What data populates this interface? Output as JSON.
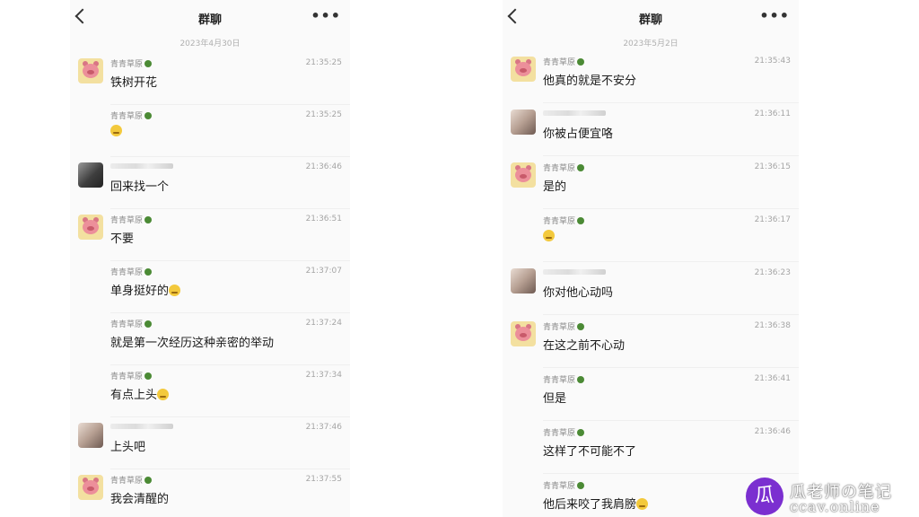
{
  "left": {
    "title": "群聊",
    "more": "•••",
    "date": "2023年4月30日",
    "messages": [
      {
        "avatar": "pig",
        "name": "青青草原",
        "time": "21:35:25",
        "text": "铁树开花",
        "emoji": false
      },
      {
        "avatar": "none",
        "name": "青青草原",
        "time": "21:35:25",
        "text": "",
        "emoji": true
      },
      {
        "avatar": "dark",
        "name": "",
        "time": "21:36:46",
        "text": "回来找一个",
        "emoji": false
      },
      {
        "avatar": "pig",
        "name": "青青草原",
        "time": "21:36:51",
        "text": "不要",
        "emoji": false
      },
      {
        "avatar": "none",
        "name": "青青草原",
        "time": "21:37:07",
        "text": "单身挺好的",
        "emoji": true
      },
      {
        "avatar": "none",
        "name": "青青草原",
        "time": "21:37:24",
        "text": "就是第一次经历这种亲密的举动",
        "emoji": false
      },
      {
        "avatar": "none",
        "name": "青青草原",
        "time": "21:37:34",
        "text": "有点上头",
        "emoji": true
      },
      {
        "avatar": "skin",
        "name": "",
        "time": "21:37:46",
        "text": "上头吧",
        "emoji": false
      },
      {
        "avatar": "pig",
        "name": "青青草原",
        "time": "21:37:55",
        "text": "我会清醒的",
        "emoji": false
      }
    ]
  },
  "right": {
    "title": "群聊",
    "more": "•••",
    "date": "2023年5月2日",
    "messages": [
      {
        "avatar": "pig",
        "name": "青青草原",
        "time": "21:35:43",
        "text": "他真的就是不安分",
        "emoji": false
      },
      {
        "avatar": "skin",
        "name": "",
        "time": "21:36:11",
        "text": "你被占便宜咯",
        "emoji": false
      },
      {
        "avatar": "pig",
        "name": "青青草原",
        "time": "21:36:15",
        "text": "是的",
        "emoji": false
      },
      {
        "avatar": "none",
        "name": "青青草原",
        "time": "21:36:17",
        "text": "",
        "emoji": true
      },
      {
        "avatar": "skin",
        "name": "",
        "time": "21:36:23",
        "text": "你对他心动吗",
        "emoji": false
      },
      {
        "avatar": "pig",
        "name": "青青草原",
        "time": "21:36:38",
        "text": "在这之前不心动",
        "emoji": false
      },
      {
        "avatar": "none",
        "name": "青青草原",
        "time": "21:36:41",
        "text": "但是",
        "emoji": false
      },
      {
        "avatar": "none",
        "name": "青青草原",
        "time": "21:36:46",
        "text": "这样了不可能不了",
        "emoji": false
      },
      {
        "avatar": "none",
        "name": "青青草原",
        "time": "",
        "text": "他后来咬了我肩膀",
        "emoji": true
      }
    ]
  },
  "watermark": {
    "badge": "瓜",
    "chinese": "瓜老师の笔记",
    "url": "ccav.online"
  },
  "colors": {
    "panel_bg": "#fafafa",
    "time_text": "#a5a5a5",
    "name_text": "#8a8a8a",
    "leaf_green": "#4b8a35",
    "watermark_badge": "#7b2fd0"
  }
}
